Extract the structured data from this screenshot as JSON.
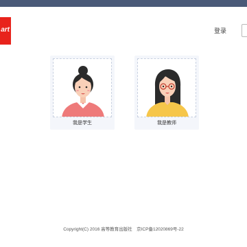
{
  "colors": {
    "topbar": "#4a5a78",
    "logo": "#e8231c",
    "card_bg": "#f4f6fb",
    "student_shirt": "#ee7a7a",
    "teacher_shirt": "#f6c64a"
  },
  "header": {
    "logo_text": "art",
    "login_label": "登录"
  },
  "roles": [
    {
      "label": "我是学生",
      "avatar": "student-avatar"
    },
    {
      "label": "我是教师",
      "avatar": "teacher-avatar"
    }
  ],
  "footer": {
    "copyright": "Copyright(C) 2016 高等教育出版社　京ICP备12020869号-22"
  }
}
